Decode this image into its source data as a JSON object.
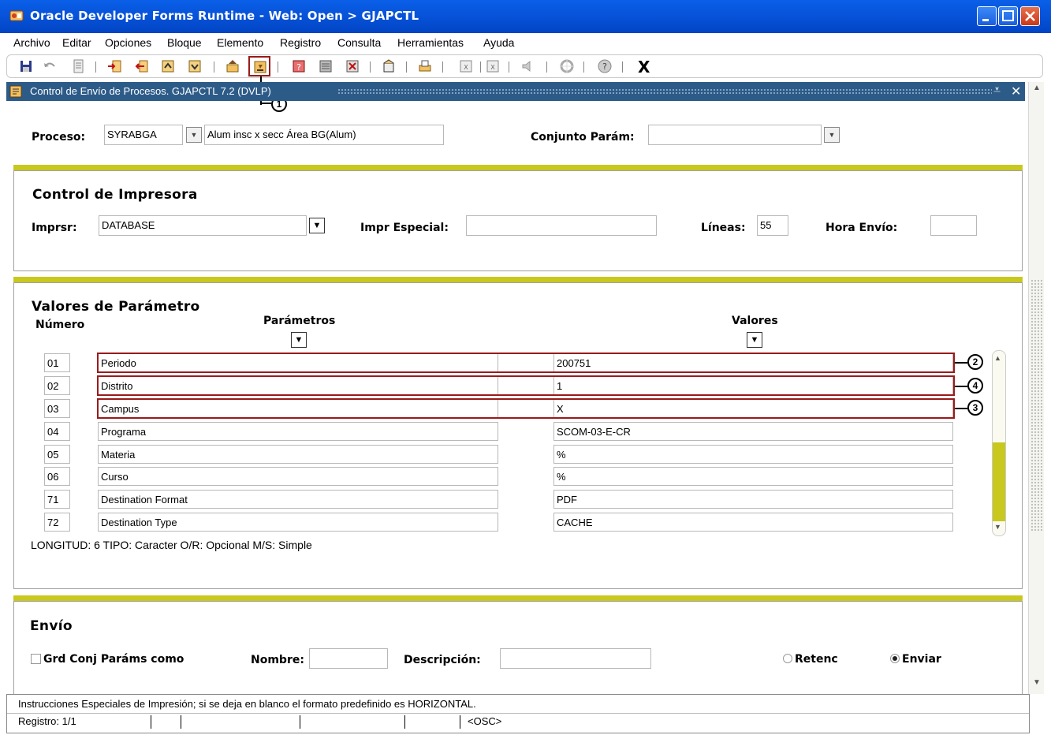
{
  "window": {
    "title": "Oracle Developer Forms Runtime - Web:  Open > GJAPCTL"
  },
  "menu": [
    "Archivo",
    "Editar",
    "Opciones",
    "Bloque",
    "Elemento",
    "Registro",
    "Consulta",
    "Herramientas",
    "Ayuda"
  ],
  "toolbar": {
    "exit_label": "X"
  },
  "form": {
    "title": "Control de Envío de Procesos.  GJAPCTL  7.2  (DVLP)"
  },
  "header": {
    "proceso_label": "Proceso:",
    "proceso_value": "SYRABGA",
    "proceso_desc": "Alum insc x secc Área BG(Alum)",
    "conjunto_label": "Conjunto Parám:",
    "conjunto_value": ""
  },
  "printer": {
    "title": "Control de Impresora",
    "imprsr_label": "Imprsr:",
    "imprsr_value": "DATABASE",
    "special_label": "Impr Especial:",
    "special_value": "",
    "lines_label": "Líneas:",
    "lines_value": "55",
    "time_label": "Hora Envío:",
    "time_value": ""
  },
  "params": {
    "title": "Valores de Parámetro",
    "col_number": "Número",
    "col_params": "Parámetros",
    "col_values": "Valores",
    "rows": [
      {
        "num": "01",
        "param": "Periodo",
        "value": "200751"
      },
      {
        "num": "02",
        "param": "Distrito",
        "value": "1"
      },
      {
        "num": "03",
        "param": "Campus",
        "value": "X"
      },
      {
        "num": "04",
        "param": "Programa",
        "value": "SCOM-03-E-CR"
      },
      {
        "num": "05",
        "param": "Materia",
        "value": "%"
      },
      {
        "num": "06",
        "param": "Curso",
        "value": "%"
      },
      {
        "num": "71",
        "param": "Destination Format",
        "value": "PDF"
      },
      {
        "num": "72",
        "param": "Destination Type",
        "value": "CACHE"
      }
    ],
    "hint": "LONGITUD: 6 TIPO: Caracter O/R: Opcional M/S: Simple"
  },
  "callouts": {
    "c1": "1",
    "c2": "2",
    "c3": "3",
    "c4": "4"
  },
  "submit": {
    "title": "Envío",
    "save_label": "Grd Conj Paráms como",
    "name_label": "Nombre:",
    "name_value": "",
    "desc_label": "Descripción:",
    "desc_value": "",
    "hold_label": "Retenc",
    "send_label": "Enviar"
  },
  "status": {
    "message": "Instrucciones Especiales de Impresión; si se deja en blanco el formato predefinido es HORIZONTAL.",
    "record": "Registro: 1/1",
    "osc": "<OSC>"
  },
  "colors": {
    "accent": "#c8c81e",
    "highlight": "#9a1a1a",
    "formbar": "#2d5b88"
  }
}
